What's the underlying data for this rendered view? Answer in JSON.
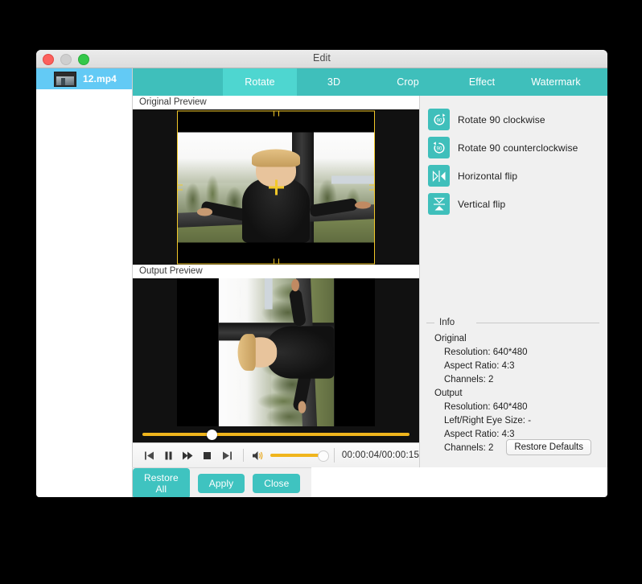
{
  "window": {
    "title": "Edit",
    "controls": {
      "close": "close-button",
      "minimize": "minimize-button",
      "maximize": "maximize-button"
    }
  },
  "filelist": {
    "items": [
      {
        "name": "12.mp4",
        "selected": true
      }
    ]
  },
  "tabs": [
    {
      "label": "Rotate",
      "active": true
    },
    {
      "label": "3D",
      "active": false
    },
    {
      "label": "Crop",
      "active": false
    },
    {
      "label": "Effect",
      "active": false
    },
    {
      "label": "Watermark",
      "active": false
    }
  ],
  "previews": {
    "original_label": "Original Preview",
    "output_label": "Output Preview"
  },
  "transport": {
    "buttons": [
      "previous-button",
      "pause-button",
      "fast-forward-button",
      "stop-button",
      "next-button"
    ],
    "timecode": "00:00:04/00:00:15",
    "timeline_position_percent": 26,
    "volume_percent": 100
  },
  "rotate_options": [
    {
      "label": "Rotate 90 clockwise",
      "icon": "rotate-clockwise-icon"
    },
    {
      "label": "Rotate 90 counterclockwise",
      "icon": "rotate-counterclockwise-icon"
    },
    {
      "label": "Horizontal flip",
      "icon": "horizontal-flip-icon"
    },
    {
      "label": "Vertical flip",
      "icon": "vertical-flip-icon"
    }
  ],
  "info": {
    "legend": "Info",
    "original_heading": "Original",
    "original_items": [
      "Resolution: 640*480",
      "Aspect Ratio: 4:3",
      "Channels: 2"
    ],
    "output_heading": "Output",
    "output_items": [
      "Resolution: 640*480",
      "Left/Right Eye Size: -",
      "Aspect Ratio: 4:3",
      "Channels: 2"
    ],
    "restore_defaults_label": "Restore Defaults"
  },
  "footer": {
    "restore_all_label": "Restore All",
    "apply_label": "Apply",
    "close_label": "Close"
  },
  "colors": {
    "tab_bar": "#3fbfbb",
    "tab_active": "#4ed6d0",
    "selection_blue": "#63caf5",
    "accent_yellow": "#f2c829",
    "button_teal": "#3fc3c0"
  }
}
